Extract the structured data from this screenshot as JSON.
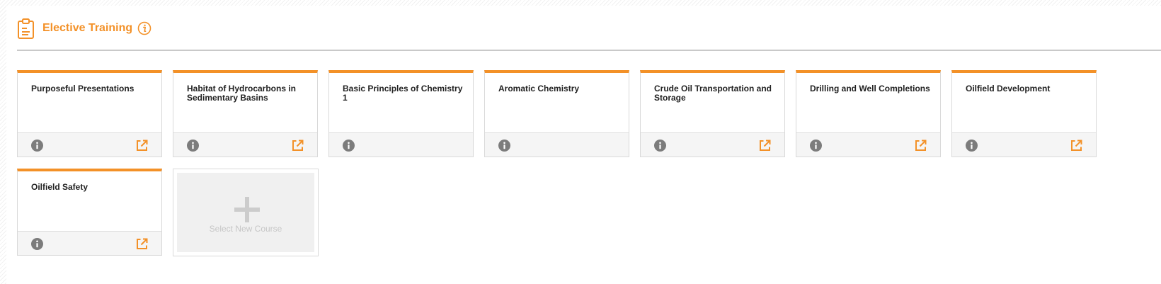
{
  "section": {
    "title": "Elective Training",
    "title_icon": "clipboard-icon",
    "info_icon": "info-circle-icon"
  },
  "theme": {
    "accent": "#f39128",
    "card_border": "#d9d9d9",
    "footer_bg": "#f5f5f5",
    "info_icon_bg": "#7c7c7c"
  },
  "courses": [
    {
      "title": "Purposeful Presentations",
      "has_open_link": true
    },
    {
      "title": "Habitat of Hydrocarbons in Sedimentary Basins",
      "has_open_link": true
    },
    {
      "title": "Basic Principles of Chemistry 1",
      "has_open_link": false
    },
    {
      "title": "Aromatic Chemistry",
      "has_open_link": false
    },
    {
      "title": "Crude Oil Transportation and Storage",
      "has_open_link": true
    },
    {
      "title": "Drilling and Well Completions",
      "has_open_link": true
    },
    {
      "title": "Oilfield Development",
      "has_open_link": true
    },
    {
      "title": "Oilfield Safety",
      "has_open_link": true
    }
  ],
  "new_course": {
    "label": "Select New Course",
    "icon": "plus-icon"
  }
}
